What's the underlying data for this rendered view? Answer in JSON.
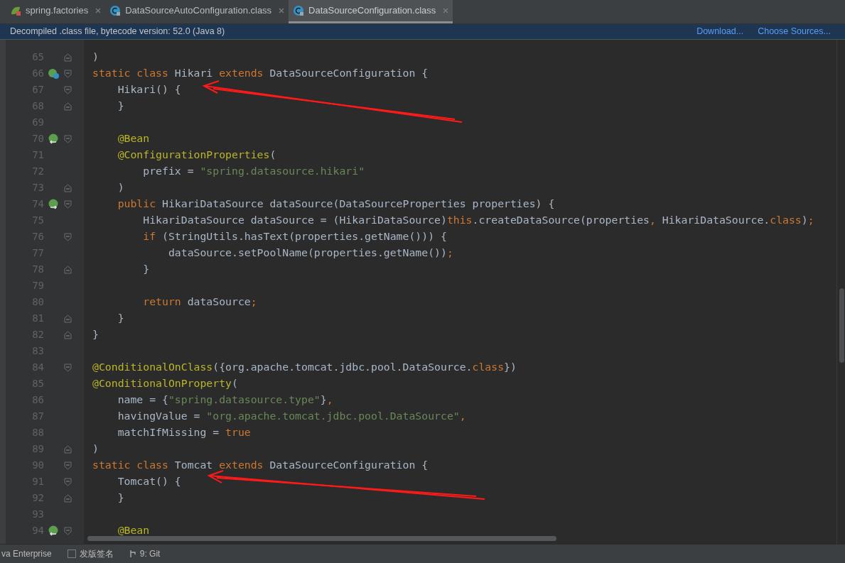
{
  "tabs": [
    {
      "label": "spring.factories",
      "selected": false
    },
    {
      "label": "DataSourceAutoConfiguration.class",
      "selected": false
    },
    {
      "label": "DataSourceConfiguration.class",
      "selected": true
    }
  ],
  "banner": {
    "message": "Decompiled .class file, bytecode version: 52.0 (Java 8)",
    "links": [
      "Download...",
      "Choose Sources..."
    ]
  },
  "lines": [
    {
      "number": "65",
      "fold": {
        "kind": "end"
      },
      "tokens": [
        {
          "kind": "plain",
          "t": ")"
        }
      ]
    },
    {
      "number": "66",
      "fold": {
        "kind": "start"
      },
      "gutter_icon": {
        "kind": "class"
      },
      "tokens": [
        {
          "kind": "keyword",
          "t": "static class "
        },
        {
          "kind": "plain",
          "t": "Hikari "
        },
        {
          "kind": "keyword",
          "t": "extends "
        },
        {
          "kind": "plain",
          "t": "DataSourceConfiguration {"
        }
      ]
    },
    {
      "number": "67",
      "fold": {
        "kind": "start"
      },
      "tokens": [
        {
          "kind": "plain",
          "t": "    Hikari() {"
        }
      ]
    },
    {
      "number": "68",
      "fold": {
        "kind": "end"
      },
      "tokens": [
        {
          "kind": "plain",
          "t": "    }"
        }
      ]
    },
    {
      "number": "69"
    },
    {
      "number": "70",
      "fold": {
        "kind": "start"
      },
      "gutter_icon": {
        "kind": "in"
      },
      "tokens": [
        {
          "kind": "annotation",
          "t": "    @Bean"
        }
      ]
    },
    {
      "number": "71",
      "tokens": [
        {
          "kind": "annotation",
          "t": "    @ConfigurationProperties"
        },
        {
          "kind": "plain",
          "t": "("
        }
      ]
    },
    {
      "number": "72",
      "tokens": [
        {
          "kind": "plain",
          "t": "        prefix = "
        },
        {
          "kind": "string",
          "t": "\"spring.datasource.hikari\""
        }
      ]
    },
    {
      "number": "73",
      "fold": {
        "kind": "end"
      },
      "tokens": [
        {
          "kind": "plain",
          "t": "    )"
        }
      ]
    },
    {
      "number": "74",
      "fold": {
        "kind": "start"
      },
      "gutter_icon": {
        "kind": "out"
      },
      "tokens": [
        {
          "kind": "keyword",
          "t": "    public "
        },
        {
          "kind": "plain",
          "t": "HikariDataSource dataSource(DataSourceProperties properties) {"
        }
      ]
    },
    {
      "number": "75",
      "tokens": [
        {
          "kind": "plain",
          "t": "        HikariDataSource dataSource = (HikariDataSource)"
        },
        {
          "kind": "keyword",
          "t": "this"
        },
        {
          "kind": "plain",
          "t": ".createDataSource(properties"
        },
        {
          "kind": "keyword",
          "t": ", "
        },
        {
          "kind": "plain",
          "t": "HikariDataSource."
        },
        {
          "kind": "keyword",
          "t": "class"
        },
        {
          "kind": "plain",
          "t": ")"
        },
        {
          "kind": "keyword",
          "t": ";"
        }
      ]
    },
    {
      "number": "76",
      "fold": {
        "kind": "start"
      },
      "tokens": [
        {
          "kind": "keyword",
          "t": "        if "
        },
        {
          "kind": "plain",
          "t": "(StringUtils.hasText(properties.getName())) {"
        }
      ]
    },
    {
      "number": "77",
      "tokens": [
        {
          "kind": "plain",
          "t": "            dataSource.setPoolName(properties.getName())"
        },
        {
          "kind": "keyword",
          "t": ";"
        }
      ]
    },
    {
      "number": "78",
      "fold": {
        "kind": "end"
      },
      "tokens": [
        {
          "kind": "plain",
          "t": "        }"
        }
      ]
    },
    {
      "number": "79"
    },
    {
      "number": "80",
      "tokens": [
        {
          "kind": "keyword",
          "t": "        return "
        },
        {
          "kind": "plain",
          "t": "dataSource"
        },
        {
          "kind": "keyword",
          "t": ";"
        }
      ]
    },
    {
      "number": "81",
      "fold": {
        "kind": "end"
      },
      "tokens": [
        {
          "kind": "plain",
          "t": "    }"
        }
      ]
    },
    {
      "number": "82",
      "fold": {
        "kind": "end"
      },
      "tokens": [
        {
          "kind": "plain",
          "t": "}"
        }
      ]
    },
    {
      "number": "83"
    },
    {
      "number": "84",
      "fold": {
        "kind": "start"
      },
      "tokens": [
        {
          "kind": "annotation",
          "t": "@ConditionalOnClass"
        },
        {
          "kind": "plain",
          "t": "({org.apache.tomcat.jdbc.pool.DataSource."
        },
        {
          "kind": "keyword",
          "t": "class"
        },
        {
          "kind": "plain",
          "t": "})"
        }
      ]
    },
    {
      "number": "85",
      "tokens": [
        {
          "kind": "annotation",
          "t": "@ConditionalOnProperty"
        },
        {
          "kind": "plain",
          "t": "("
        }
      ]
    },
    {
      "number": "86",
      "tokens": [
        {
          "kind": "plain",
          "t": "    name = {"
        },
        {
          "kind": "string",
          "t": "\"spring.datasource.type\""
        },
        {
          "kind": "plain",
          "t": "}"
        },
        {
          "kind": "keyword",
          "t": ","
        }
      ]
    },
    {
      "number": "87",
      "tokens": [
        {
          "kind": "plain",
          "t": "    havingValue = "
        },
        {
          "kind": "string",
          "t": "\"org.apache.tomcat.jdbc.pool.DataSource\""
        },
        {
          "kind": "keyword",
          "t": ","
        }
      ]
    },
    {
      "number": "88",
      "tokens": [
        {
          "kind": "plain",
          "t": "    matchIfMissing = "
        },
        {
          "kind": "keyword",
          "t": "true"
        }
      ]
    },
    {
      "number": "89",
      "fold": {
        "kind": "end"
      },
      "tokens": [
        {
          "kind": "plain",
          "t": ")"
        }
      ]
    },
    {
      "number": "90",
      "fold": {
        "kind": "start"
      },
      "tokens": [
        {
          "kind": "keyword",
          "t": "static class "
        },
        {
          "kind": "plain",
          "t": "Tomcat "
        },
        {
          "kind": "keyword",
          "t": "extends "
        },
        {
          "kind": "plain",
          "t": "DataSourceConfiguration {"
        }
      ]
    },
    {
      "number": "91",
      "fold": {
        "kind": "start"
      },
      "tokens": [
        {
          "kind": "plain",
          "t": "    Tomcat() {"
        }
      ]
    },
    {
      "number": "92",
      "fold": {
        "kind": "end"
      },
      "tokens": [
        {
          "kind": "plain",
          "t": "    }"
        }
      ]
    },
    {
      "number": "93"
    },
    {
      "number": "94",
      "fold": {
        "kind": "start"
      },
      "gutter_icon": {
        "kind": "in"
      },
      "tokens": [
        {
          "kind": "annotation",
          "t": "    @Bean"
        }
      ]
    }
  ],
  "status_bar": {
    "items": [
      {
        "kind": "text",
        "label": "va Enterprise"
      },
      {
        "kind": "checkbox",
        "label": "发版签名",
        "checked": false
      },
      {
        "kind": "git",
        "label": "9: Git"
      }
    ]
  }
}
